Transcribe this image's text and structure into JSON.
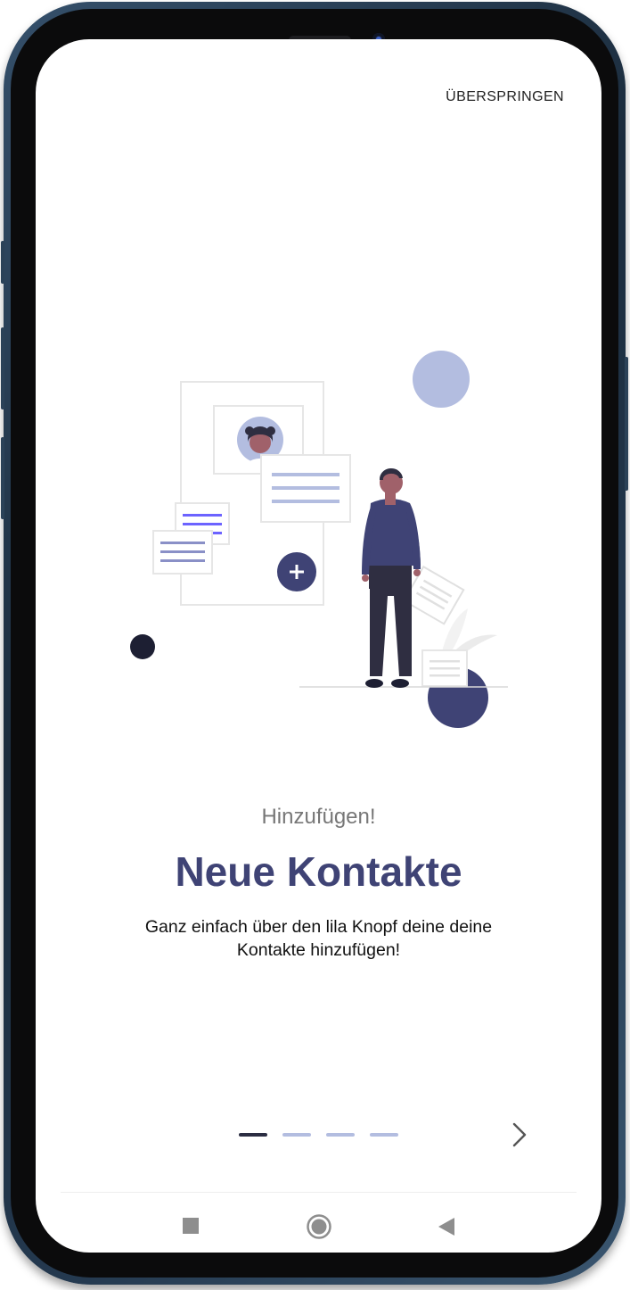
{
  "header": {
    "skip_label": "ÜBERSPRINGEN"
  },
  "onboarding": {
    "subtitle": "Hinzufügen!",
    "title": "Neue Kontakte",
    "description": "Ganz einfach über den lila Knopf deine deine Kontakte hinzufügen!",
    "page_indicator": {
      "current": 1,
      "total": 4
    }
  },
  "icons": {
    "next": "chevron-right-icon",
    "nav_recent": "square-icon",
    "nav_home": "circle-icon",
    "nav_back": "triangle-back-icon"
  },
  "colors": {
    "accent": "#3f4375",
    "accent_light": "#b3bde0",
    "dot_active": "#2b2d42",
    "text_dark": "#111111"
  }
}
